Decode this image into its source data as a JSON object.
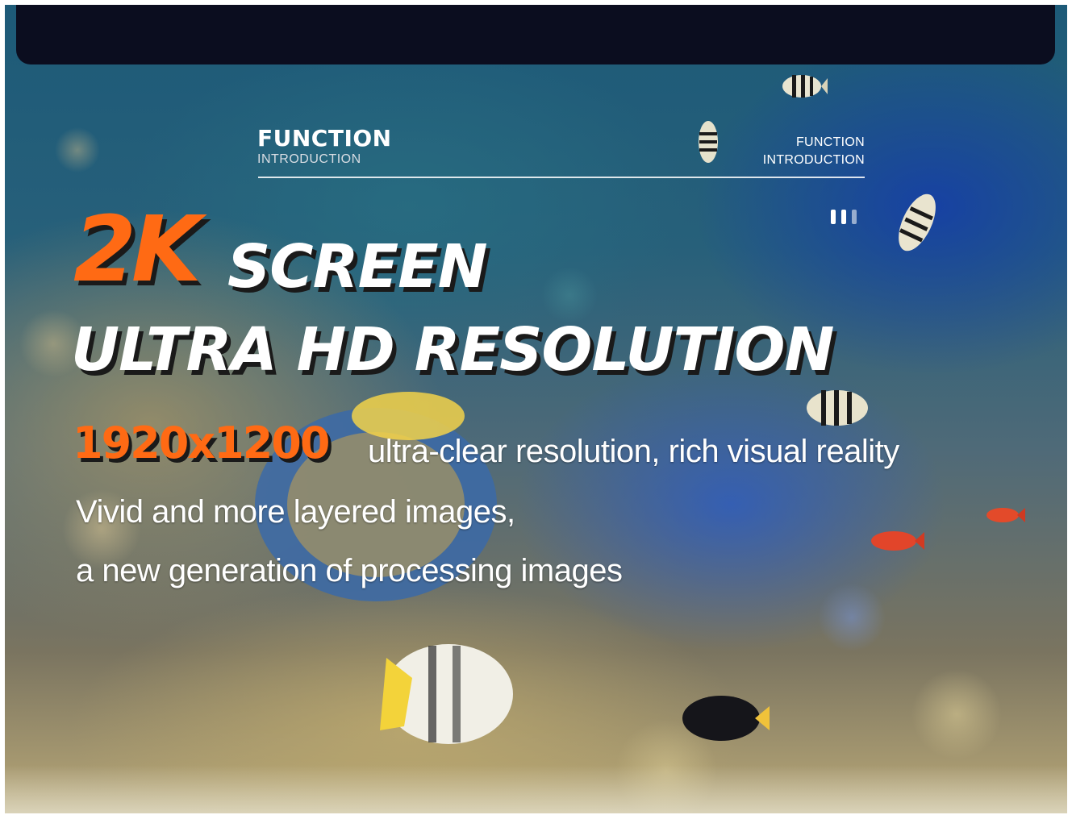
{
  "header_left": {
    "title": "FUNCTION",
    "subtitle": "INTRODUCTION"
  },
  "header_right": {
    "line1": "FUNCTION",
    "line2": "INTRODUCTION"
  },
  "pager": {
    "total": 3,
    "active_count": 2
  },
  "headline": {
    "highlight": "2K",
    "word": "SCREEN",
    "line2": "ULTRA HD RESOLUTION"
  },
  "resolution": {
    "value": "1920x1200",
    "caption": "ultra-clear resolution, rich visual reality"
  },
  "description": {
    "line1": "Vivid and more layered images,",
    "line2": "a new generation of processing images"
  },
  "colors": {
    "accent": "#ff6a14",
    "top_bar": "#0b0d1f",
    "text": "#ffffff"
  },
  "background": "underwater-coral-reef-with-tropical-fish"
}
